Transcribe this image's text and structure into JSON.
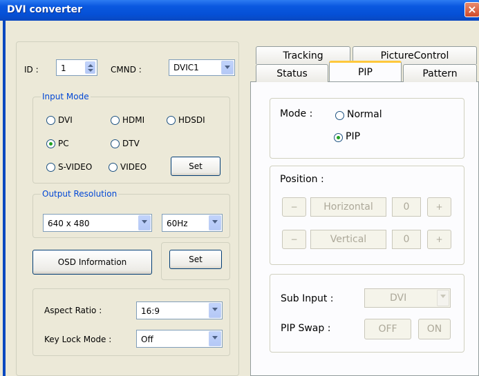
{
  "window": {
    "title": "DVI converter",
    "close_glyph": "×"
  },
  "header": {
    "id_label": "ID :",
    "id_value": "1",
    "cmnd_label": "CMND :",
    "cmnd_value": "DVIC1"
  },
  "input_mode": {
    "legend": "Input Mode",
    "options": [
      {
        "label": "DVI",
        "checked": false
      },
      {
        "label": "HDMI",
        "checked": false
      },
      {
        "label": "HDSDI",
        "checked": false
      },
      {
        "label": "PC",
        "checked": true
      },
      {
        "label": "DTV",
        "checked": false
      },
      {
        "label": "S-VIDEO",
        "checked": false
      },
      {
        "label": "VIDEO",
        "checked": false
      }
    ],
    "set_label": "Set"
  },
  "output_resolution": {
    "legend": "Output Resolution",
    "resolution": "640 x 480",
    "refresh": "60Hz"
  },
  "osd": {
    "info_label": "OSD  Information",
    "set_label": "Set"
  },
  "settings": {
    "aspect_label": "Aspect Ratio :",
    "aspect_value": "16:9",
    "keylock_label": "Key Lock Mode :",
    "keylock_value": "Off"
  },
  "tabs": {
    "row1": [
      "Tracking",
      "PictureControl"
    ],
    "row2": [
      "Status",
      "PIP",
      "Pattern"
    ],
    "selected": "PIP"
  },
  "pip": {
    "mode_label": "Mode :",
    "mode_options": [
      {
        "label": "Normal",
        "checked": false
      },
      {
        "label": "PIP",
        "checked": true
      }
    ],
    "position_label": "Position :",
    "minus": "−",
    "plus": "+",
    "horizontal_label": "Horizontal",
    "horizontal_value": "0",
    "vertical_label": "Vertical",
    "vertical_value": "0",
    "sub_input_label": "Sub Input :",
    "sub_input_value": "DVI",
    "swap_label": "PIP Swap :",
    "off_label": "OFF",
    "on_label": "ON"
  }
}
